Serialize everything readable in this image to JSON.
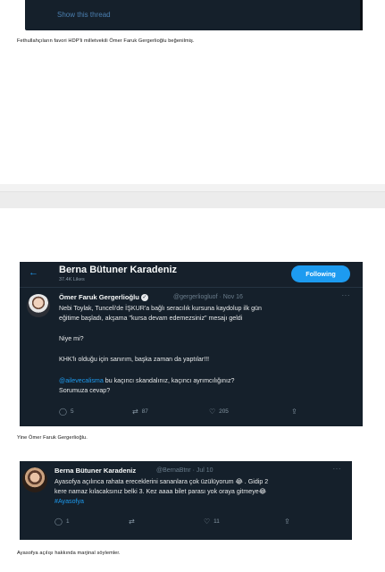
{
  "top_tweet": {
    "show_thread": "Show this thread"
  },
  "caption_1": "Fethullahçıların favori HDP'li milletvekili Ömer Faruk Gergerlioğlu beğenilmiş.",
  "tweet_2": {
    "header_title": "Berna Bütuner Karadeniz",
    "header_likes": "37.4K Likes",
    "follow_label": "Following",
    "back_icon": "arrow-left-icon",
    "author_name": "Ömer Faruk Gergerlioğlu",
    "handle_date": "@gergerliogluof · Nov 16",
    "lines": [
      "Nebi Toylak, Tunceli'de İŞKUR'a bağlı seracılık kursuna kaydolup ilk gün",
      "eğitime başladı, akşama \"kursa devam edemezsiniz\" mesajı geldi",
      "Niye mi?",
      "KHK'lı olduğu için sanırım, başka zaman da yaptılar!!!"
    ],
    "mention": "@ailevecalisma",
    "mention_rest": " bu kaçıncı skandalınız, kaçıncı ayrımcılığınız?",
    "last_line": "Sorumuza cevap?",
    "replies": "5",
    "retweets": "87",
    "likes": "205"
  },
  "caption_2": "Yine Ömer Faruk Gergerlioğlu.",
  "tweet_3": {
    "author_name": "Berna Bütuner Karadeniz",
    "handle_date": "@BernaBtnr · Jul 10",
    "line_1": "Ayasofya açılınca rahata ereceklerini sananlara çok üzülüyorum 😂 . Gidip 2",
    "line_2": "kere namaz kılacaksınız belki 3. Kez aaaa bilet parası yok oraya gitmeye😂",
    "hashtag": "#Ayasofya",
    "replies": "1",
    "likes": "11"
  },
  "caption_3": "Ayasofya açılışı hakkında marjinal söylemler.",
  "colors": {
    "tweet_bg": "#15202b",
    "accent": "#1d9bf0",
    "muted": "#8899a6"
  }
}
